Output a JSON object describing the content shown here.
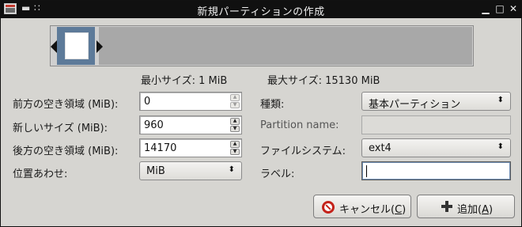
{
  "window": {
    "title": "新規パーティションの作成",
    "menu_glyph": "▬",
    "pin_glyph": "∷",
    "minimize_glyph": "▁",
    "maximize_glyph": "□",
    "close_glyph": "✕"
  },
  "colors": {
    "selected_partition": "#5d7a99",
    "unallocated": "#a8a8a8",
    "cancel_icon": "#c4221a"
  },
  "size_info": {
    "min": "最小サイズ: 1 MiB",
    "max": "最大サイズ: 15130 MiB"
  },
  "fields": {
    "free_before": {
      "label": "前方の空き領域 (MiB):",
      "value": "0",
      "up": "▲",
      "down": "▼"
    },
    "new_size": {
      "label": "新しいサイズ (MiB):",
      "value": "960",
      "up": "▲",
      "down": "▼"
    },
    "free_after": {
      "label": "後方の空き領域 (MiB):",
      "value": "14170",
      "up": "▲",
      "down": "▼"
    },
    "align": {
      "label": "位置あわせ:",
      "value": "MiB",
      "arrow": "⬍"
    },
    "type": {
      "label": "種類:",
      "value": "基本パーティション",
      "arrow": "⬍"
    },
    "partition_name": {
      "label": "Partition name:",
      "value": ""
    },
    "filesystem": {
      "label": "ファイルシステム:",
      "value": "ext4",
      "arrow": "⬍"
    },
    "label": {
      "label": "ラベル:",
      "value": ""
    }
  },
  "buttons": {
    "cancel": {
      "text": "キャンセル(",
      "mnemonic": "C",
      "close": ")",
      "icon": "cancel-icon"
    },
    "add": {
      "text": "追加(",
      "mnemonic": "A",
      "close": ")",
      "icon": "plus-icon"
    }
  }
}
